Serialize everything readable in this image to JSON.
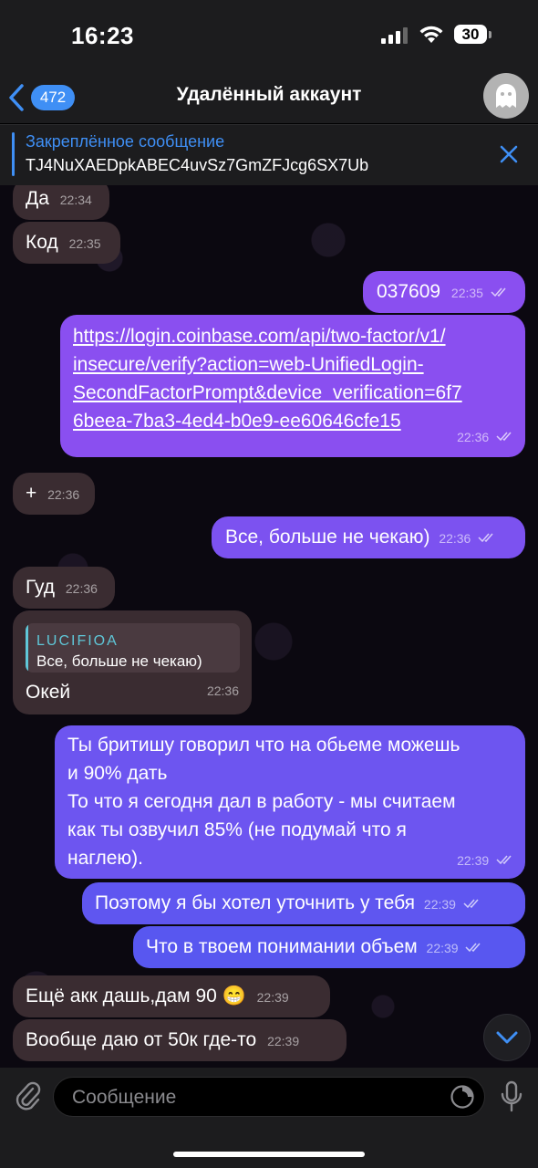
{
  "status": {
    "time": "16:23",
    "battery": "30"
  },
  "header": {
    "back_count": "472",
    "title": "Удалённый аккаунт"
  },
  "pinned": {
    "title": "Закреплённое сообщение",
    "text": "TJ4NuXAEDpkABEC4uvSz7GmZFJcg6SX7Ub"
  },
  "messages": [
    {
      "dir": "in",
      "text": "Да",
      "time": "22:34"
    },
    {
      "dir": "in",
      "text": "Код",
      "time": "22:35"
    },
    {
      "dir": "out",
      "text": "037609",
      "time": "22:35"
    },
    {
      "dir": "out",
      "lines": [
        "https://login.coinbase.com/api/two-factor/v1/",
        "insecure/verify?action=web-UnifiedLogin-",
        "SecondFactorPrompt&device_verification=6f7",
        "6beea-7ba3-4ed4-b0e9-ee60646cfe15"
      ],
      "time": "22:36"
    },
    {
      "dir": "in",
      "text": "+",
      "time": "22:36"
    },
    {
      "dir": "out",
      "text": "Все, больше не чекаю)",
      "time": "22:36"
    },
    {
      "dir": "in",
      "text": "Гуд",
      "time": "22:36"
    },
    {
      "dir": "in",
      "reply_name": "LUCIFIOA",
      "reply_text": "Все, больше не чекаю)",
      "text": "Окей",
      "time": "22:36"
    },
    {
      "dir": "out",
      "lines": [
        "Ты бритишу говорил что на обьеме можешь",
        "и 90% дать",
        "То что я сегодня дал в работу - мы считаем",
        "как ты озвучил 85% (не подумай что я",
        "наглею)."
      ],
      "time": "22:39"
    },
    {
      "dir": "out",
      "text": "Поэтому я бы хотел уточнить у тебя",
      "time": "22:39"
    },
    {
      "dir": "out",
      "text": "Что в твоем понимании объем",
      "time": "22:39"
    },
    {
      "dir": "in",
      "text": "Ещё акк дашь,дам 90 😁",
      "time": "22:39"
    },
    {
      "dir": "in",
      "text": "Вообще даю от 50к где-то",
      "time": "22:39"
    }
  ],
  "input": {
    "placeholder": "Сообщение"
  },
  "icons": [
    "back-chevron-icon",
    "ghost-avatar-icon",
    "close-icon",
    "paperclip-icon",
    "sticker-icon",
    "microphone-icon",
    "chevron-down-icon"
  ],
  "colors": {
    "accent": "#3f8ff5",
    "incoming_bubble": "#3a2c31",
    "outgoing_top": "#8b4cf0",
    "outgoing_bottom": "#5a55f0"
  }
}
